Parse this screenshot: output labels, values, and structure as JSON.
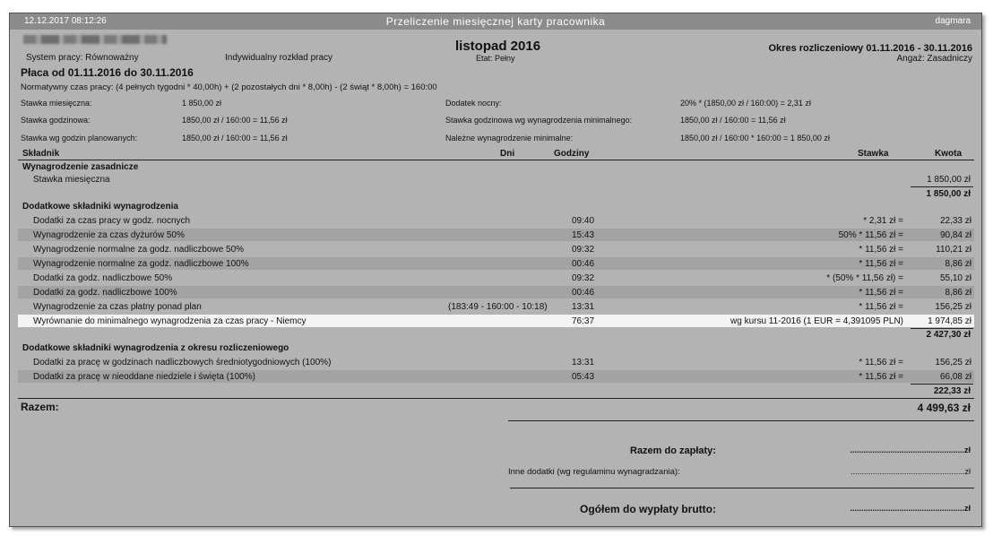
{
  "titlebar": {
    "datetime": "12.12.2017  08:12:26",
    "title": "Przeliczenie miesięcznej karty pracownika",
    "user": "dagmara"
  },
  "header": {
    "system": "System pracy: Równoważny",
    "schedule": "Indywidualny rozkład pracy",
    "month": "listopad 2016",
    "etat": "Etat: Pełny",
    "period": "Okres rozliczeniowy 01.11.2016 - 30.11.2016",
    "angaz": "Angaż: Zasadniczy",
    "placa": "Płaca od 01.11.2016 do  30.11.2016",
    "normatywny": "Normatywny czas pracy:  (4 pełnych tygodni * 40,00h) + (2 pozostałych dni * 8,00h) - (2 świąt * 8,00h) = 160:00"
  },
  "rates": {
    "miesieczna_label": "Stawka miesięczna:",
    "miesieczna_value": "1 850,00 zł",
    "godzinowa_label": "Stawka godzinowa:",
    "godzinowa_value": "1850,00 zł / 160:00 = 11,56 zł",
    "planowanych_label": "Stawka wg godzin planowanych:",
    "planowanych_value": "1850,00 zł / 160:00 = 11,56 zł",
    "nocny_label": "Dodatek nocny:",
    "nocny_value": "20% * (1850,00 zł / 160:00) = 2,31 zł",
    "minimalnego_label": "Stawka godzinowa wg wynagrodzenia minimalnego:",
    "minimalnego_value": "1850,00 zł / 160:00 = 11,56 zł",
    "nalezne_label": "Należne wynagrodzenie minimalne:",
    "nalezne_value": "1850,00 zł / 160:00 * 160:00 = 1 850,00 zł"
  },
  "columns": {
    "skladnik": "Składnik",
    "dni": "Dni",
    "godziny": "Godziny",
    "stawka": "Stawka",
    "kwota": "Kwota"
  },
  "sections": [
    {
      "title": "Wynagrodzenie zasadnicze",
      "rows": [
        {
          "name": "Stawka miesięczna",
          "dni": "",
          "godziny": "",
          "stawka": "",
          "kwota": "1 850,00 zł"
        }
      ],
      "total": "1 850,00 zł"
    },
    {
      "title": "Dodatkowe składniki wynagrodzenia",
      "rows": [
        {
          "name": "Dodatki za czas pracy w godz. nocnych",
          "dni": "",
          "godziny": "09:40",
          "stawka": "* 2,31 zł =",
          "kwota": "22,33 zł"
        },
        {
          "name": "Wynagrodzenie za czas dyżurów 50%",
          "dni": "",
          "godziny": "15:43",
          "stawka": "50% * 11,56 zł =",
          "kwota": "90,84 zł"
        },
        {
          "name": "Wynagrodzenie normalne za godz. nadliczbowe 50%",
          "dni": "",
          "godziny": "09:32",
          "stawka": "* 11,56 zł =",
          "kwota": "110,21 zł"
        },
        {
          "name": "Wynagrodzenie normalne za godz. nadliczbowe 100%",
          "dni": "",
          "godziny": "00:46",
          "stawka": "* 11,56 zł =",
          "kwota": "8,86 zł"
        },
        {
          "name": "Dodatki za godz. nadliczbowe 50%",
          "dni": "",
          "godziny": "09:32",
          "stawka": "* (50% * 11,56 zł) =",
          "kwota": "55,10 zł"
        },
        {
          "name": "Dodatki za godz. nadliczbowe 100%",
          "dni": "",
          "godziny": "00:46",
          "stawka": "* 11,56 zł =",
          "kwota": "8,86 zł"
        },
        {
          "name": "Wynagrodzenie za czas płatny ponad plan",
          "dni": "(183:49 - 160:00 - 10:18)",
          "godziny": "13:31",
          "stawka": "* 11,56 zł =",
          "kwota": "156,25 zł"
        },
        {
          "name": "Wyrównanie do minimalnego wynagrodzenia za czas pracy - Niemcy",
          "dni": "",
          "godziny": "76:37",
          "stawka": "wg kursu 11-2016 (1 EUR = 4,391095 PLN)",
          "kwota": "1 974,85 zł"
        }
      ],
      "total": "2 427,30 zł"
    },
    {
      "title": "Dodatkowe składniki wynagrodzenia z okresu rozliczeniowego",
      "rows": [
        {
          "name": "Dodatki za pracę w godzinach nadliczbowych średniotygodniowych (100%)",
          "dni": "",
          "godziny": "13:31",
          "stawka": "* 11,56 zł =",
          "kwota": "156,25 zł"
        },
        {
          "name": "Dodatki za pracę w nieoddane niedziele i święta (100%)",
          "dni": "",
          "godziny": "05:43",
          "stawka": "* 11,56 zł =",
          "kwota": "66,08 zł"
        }
      ],
      "total": "222,33 zł"
    }
  ],
  "summary": {
    "razem_label": "Razem:",
    "razem_value": "4 499,63 zł",
    "do_zaplaty_label": "Razem do zapłaty:",
    "do_zaplaty_value": "...................................................zł",
    "inne_label": "Inne dodatki (wg regulaminu wynagradzania):",
    "inne_value": "...................................................zł",
    "ogolem_label": "Ogółem do wypłaty brutto:",
    "ogolem_value": "...................................................zł"
  }
}
